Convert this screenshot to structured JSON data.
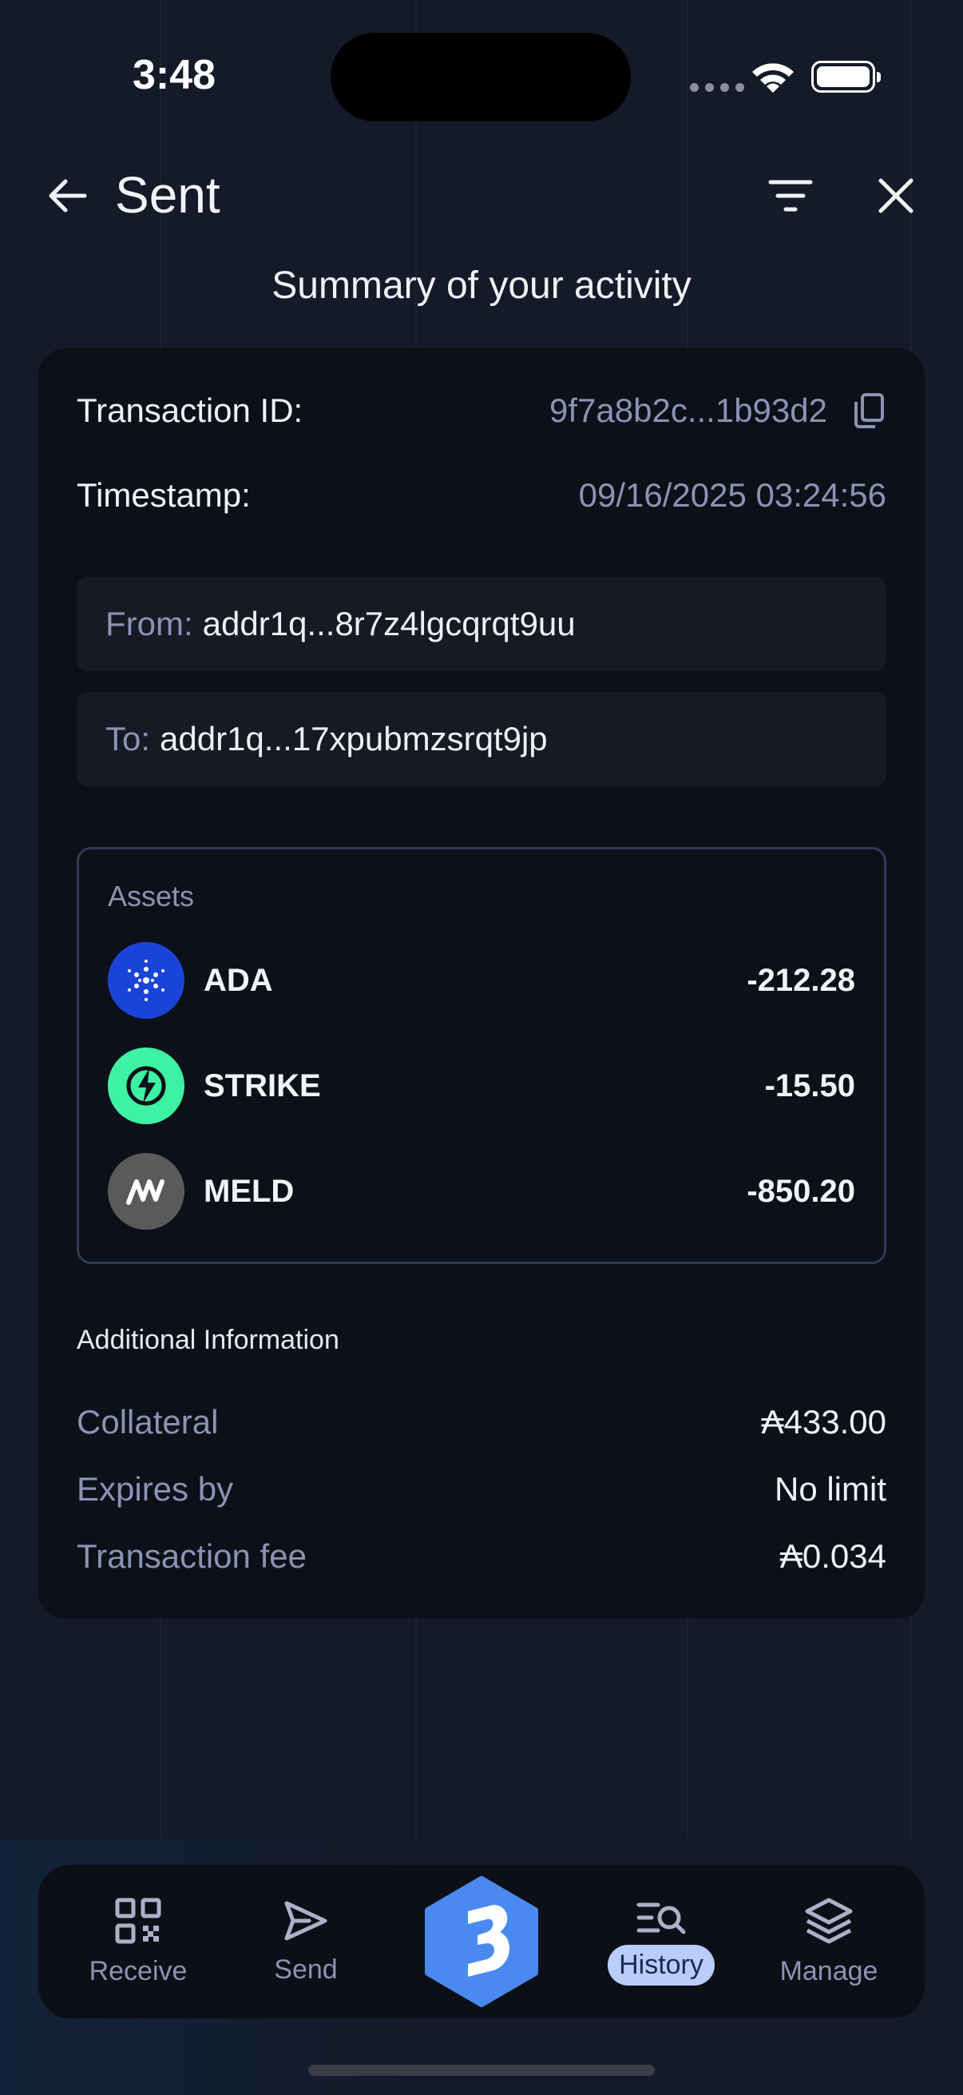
{
  "status_bar": {
    "time": "3:48"
  },
  "header": {
    "title": "Sent"
  },
  "subtitle": "Summary of your activity",
  "transaction": {
    "id_label": "Transaction ID:",
    "id_value": "9f7a8b2c...1b93d2",
    "timestamp_label": "Timestamp:",
    "timestamp_value": "09/16/2025 03:24:56",
    "from_label": "From:",
    "from_value": "addr1q...8r7z4lgcqrqt9uu",
    "to_label": "To:",
    "to_value": "addr1q...17xpubmzsrqt9jp"
  },
  "assets": {
    "title": "Assets",
    "items": [
      {
        "name": "ADA",
        "amount": "-212.28",
        "icon": "cardano-icon",
        "color": "#1a44d8"
      },
      {
        "name": "STRIKE",
        "amount": "-15.50",
        "icon": "strike-icon",
        "color": "#3ef2a3"
      },
      {
        "name": "MELD",
        "amount": "-850.20",
        "icon": "meld-icon",
        "color": "#5a5a5a"
      }
    ]
  },
  "additional": {
    "title": "Additional Information",
    "rows": [
      {
        "label": "Collateral",
        "value": "₳433.00"
      },
      {
        "label": "Expires by",
        "value": "No limit"
      },
      {
        "label": "Transaction fee",
        "value": "₳0.034"
      }
    ]
  },
  "nav": {
    "items": [
      {
        "label": "Receive",
        "icon": "qr-code-icon"
      },
      {
        "label": "Send",
        "icon": "send-icon"
      },
      {
        "label": "",
        "icon": "brand-logo-icon"
      },
      {
        "label": "History",
        "icon": "history-search-icon",
        "active": true
      },
      {
        "label": "Manage",
        "icon": "layers-icon"
      }
    ],
    "active_color": "#b9cdfb",
    "center_color": "#4a8af0"
  }
}
